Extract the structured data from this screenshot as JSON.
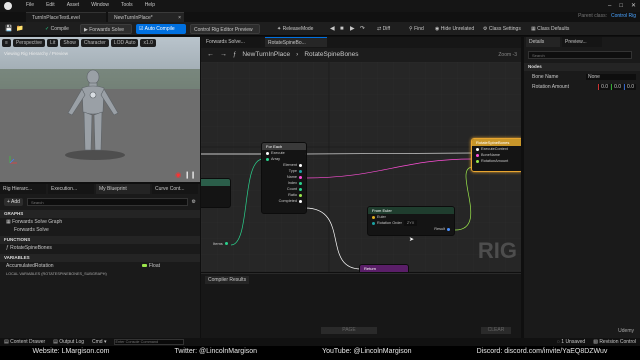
{
  "titlebar": {
    "menu": [
      "File",
      "Edit",
      "Asset",
      "Window",
      "Tools",
      "Help"
    ]
  },
  "tabs": {
    "items": [
      "TurnInPlaceTestLevel",
      "NewTurnInPlace*"
    ],
    "parent_class_label": "Parent class:",
    "parent_class_value": "Control Rig"
  },
  "toolbar": {
    "compile": "Compile",
    "forwards_solve": "Forwards Solve",
    "auto_compile": "Auto Compile",
    "preview": "Control Rig Editor Preview",
    "release_mode": "ReleaseMode",
    "diff": "Diff",
    "find": "Find",
    "hide_unrelated": "Hide Unrelated",
    "class_settings": "Class Settings",
    "class_defaults": "Class Defaults"
  },
  "viewport": {
    "chips": [
      "Perspective",
      "Lit",
      "Show",
      "Character",
      "LOD Auto",
      "x1.0"
    ],
    "label": "Viewing Rig Hierarchy / Preview"
  },
  "left": {
    "tabs": [
      "Rig Hierarc...",
      "Execution...",
      "My Blueprint",
      "Curve Cont..."
    ],
    "add": "+ Add",
    "search_placeholder": "Search",
    "graph_hdr": "GRAPHS",
    "graph_item": "Forwards Solve Graph",
    "graph_sub": "Forwards Solve",
    "func_hdr": "FUNCTIONS",
    "func_item": "RotateSpineBones",
    "var_hdr": "VARIABLES",
    "var_name": "AccumulatedRotation",
    "var_type": "Float",
    "local_hdr": "LOCAL VARIABLES (ROTATESPINEBONES_SUBGRAPH)"
  },
  "graph": {
    "tabs": [
      "Forwards Solve...",
      "RotateSpineBo..."
    ],
    "breadcrumb_root": "NewTurnInPlace",
    "breadcrumb_leaf": "RotateSpineBones",
    "zoom": "Zoom -3",
    "watermark": "RIG",
    "foreach_title": "For Each",
    "foreach_pins_in": [
      "Execute",
      "Array"
    ],
    "foreach_pins_out": [
      "Element",
      "Type",
      "Name",
      "Index",
      "Count",
      "Ratio",
      "Completed"
    ],
    "items_label": "Items",
    "rotate_title": "RotateSpineBones",
    "rotate_pins": [
      "ExecuteContext",
      "BoneName",
      "RotationAmount"
    ],
    "euler_title": "From Euler",
    "euler_pins": [
      "Euler",
      "Rotation Order",
      "Result"
    ],
    "euler_order": "ZYX",
    "return_title": "Return"
  },
  "compiler": {
    "title": "Compiler Results",
    "page": "PAGE",
    "clear": "CLEAR"
  },
  "details": {
    "tabs": [
      "Details",
      "Preview..."
    ],
    "search_placeholder": "Search",
    "section": "Nodes",
    "bone_name_label": "Bone Name",
    "bone_name_value": "None",
    "rotation_label": "Rotation Amount",
    "rotation_x": "0.0",
    "rotation_y": "0.0",
    "rotation_z": "0.0"
  },
  "statusbar": {
    "drawer": "Content Drawer",
    "output": "Output Log",
    "cmd": "Cmd",
    "cmd_placeholder": "Enter Console Command",
    "unsaved": "1 Unsaved",
    "revision": "Revision Control"
  },
  "banner": {
    "website": "Website: LMargison.com",
    "twitter": "Twitter: @LincolnMargison",
    "youtube": "YouTube: @LincolnMargison",
    "discord": "Discord: discord.com/invite/YaEQ8DZWuv"
  },
  "udemy": "Udemy",
  "colors": {
    "accent_blue": "#0070e0",
    "exec_white": "#ffffff",
    "name_pink": "#ff4fd8",
    "int_green": "#2bd28d",
    "float_green": "#9be74b",
    "rotate_gold": "#c8962a",
    "euler_header": "#1f3d2e",
    "return_header": "#5a1e68"
  }
}
